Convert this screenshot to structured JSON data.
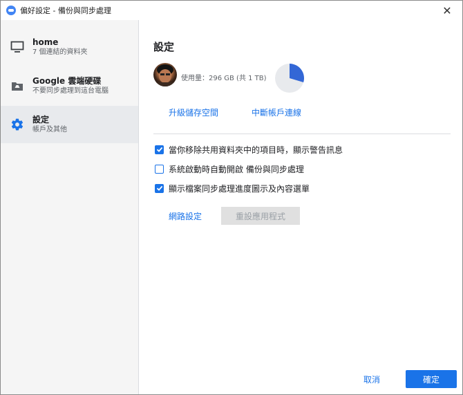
{
  "window": {
    "title": "偏好設定 - 備份與同步處理",
    "close_glyph": "✕"
  },
  "sidebar": {
    "items": [
      {
        "title": "home",
        "subtitle": "7 個連結的資料夾",
        "icon": "monitor-icon"
      },
      {
        "title": "Google 雲端硬碟",
        "subtitle": "不要同步處理到這台電腦",
        "icon": "drive-folder-icon"
      },
      {
        "title": "設定",
        "subtitle": "帳戶及其他",
        "icon": "gear-icon"
      }
    ],
    "active_index": 2
  },
  "main": {
    "heading": "設定",
    "usage_text": "使用量：296 GB (共 1 TB)",
    "storage_used_fraction": 0.296,
    "upgrade_link": "升級儲存空間",
    "disconnect_link": "中斷帳戶連線",
    "options": [
      {
        "label": "當你移除共用資料夾中的項目時，顯示警告訊息",
        "checked": true
      },
      {
        "label": "系統啟動時自動開啟 備份與同步處理",
        "checked": false
      },
      {
        "label": "顯示檔案同步處理進度圖示及內容選單",
        "checked": true
      }
    ],
    "network_link": "網路設定",
    "reset_button": "重設應用程式"
  },
  "footer": {
    "cancel_label": "取消",
    "ok_label": "確定"
  },
  "colors": {
    "accent": "#1a73e8",
    "pie_used": "#3367d6",
    "pie_free": "#e8eaed"
  }
}
